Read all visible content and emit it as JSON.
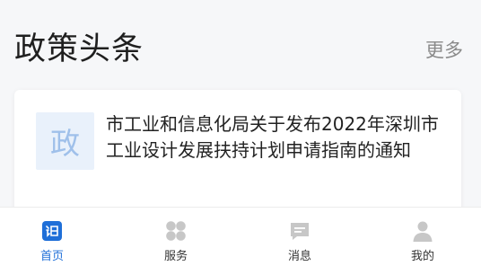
{
  "section": {
    "title": "政策头条",
    "more_label": "更多"
  },
  "news": {
    "thumb_char": "政",
    "title": "市工业和信息化局关于发布2022年深圳市工业设计发展扶持计划申请指南的通知"
  },
  "tabs": [
    {
      "label": "首页",
      "icon": "home-icon",
      "active": true
    },
    {
      "label": "服务",
      "icon": "services-icon",
      "active": false
    },
    {
      "label": "消息",
      "icon": "message-icon",
      "active": false
    },
    {
      "label": "我的",
      "icon": "profile-icon",
      "active": false
    }
  ],
  "colors": {
    "accent": "#1f6fd8",
    "inactive_icon": "#c7c7c7",
    "thumb_bg": "#e9f1fb"
  }
}
